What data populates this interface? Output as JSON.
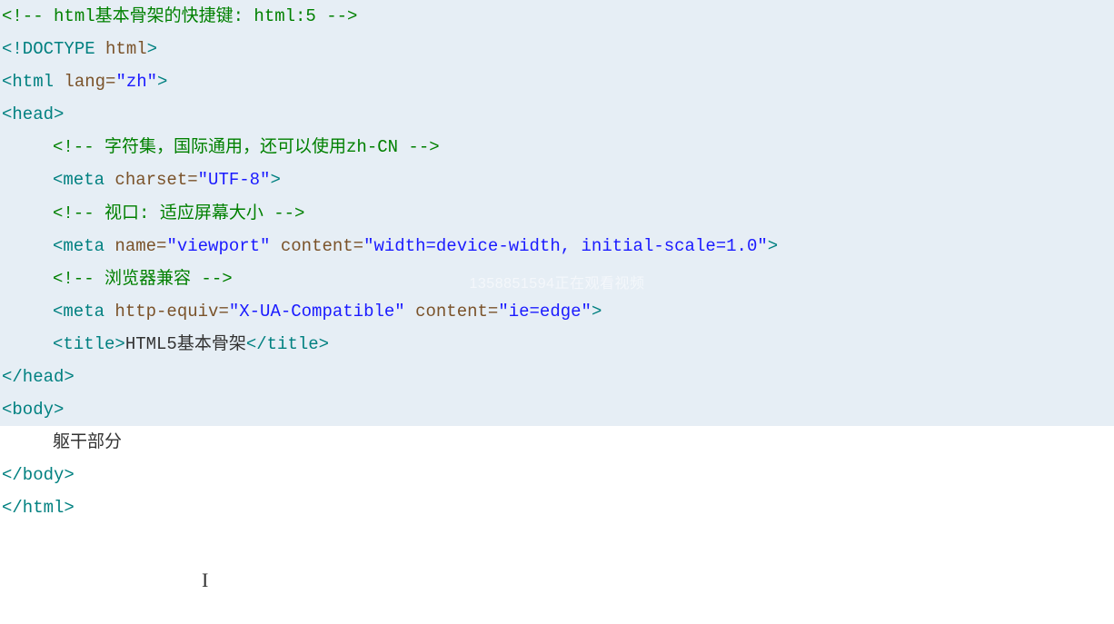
{
  "watermark": "1358851594正在观看视频",
  "cursor_char": "I",
  "code": {
    "l1": {
      "c1": "<!-- html基本骨架的快捷键: html:5 -->"
    },
    "l2": {
      "t1": "<!DOCTYPE ",
      "a1": "html",
      "t2": ">"
    },
    "l3": {
      "t1": "<html ",
      "a1": "lang=",
      "s1": "\"zh\"",
      "t2": ">"
    },
    "l4": {
      "t1": "<head>"
    },
    "l5": {
      "c1": "<!-- 字符集，国际通用，还可以使用zh-CN -->"
    },
    "l6": {
      "t1": "<meta ",
      "a1": "charset=",
      "s1": "\"UTF-8\"",
      "t2": ">"
    },
    "l7": {
      "c1": "<!-- 视口: 适应屏幕大小 -->"
    },
    "l8": {
      "t1": "<meta ",
      "a1": "name=",
      "s1": "\"viewport\"",
      "a2": " content=",
      "s2": "\"width=device-width, initial-scale=1.0\"",
      "t2": ">"
    },
    "l9": {
      "c1": "<!-- 浏览器兼容 -->"
    },
    "l10": {
      "t1": "<meta ",
      "a1": "http-equiv=",
      "s1": "\"X-UA-Compatible\"",
      "a2": " content=",
      "s2": "\"ie=edge\"",
      "t2": ">"
    },
    "l11": {
      "t1": "<title>",
      "x1": "HTML5基本骨架",
      "t2": "</title>"
    },
    "l12": {
      "t1": "</head>"
    },
    "l13": {
      "t1": "<body>"
    },
    "l14": {
      "x1": "躯干部分"
    },
    "l15": {
      "t1": "</body>"
    },
    "l16": {
      "t1": "</html>"
    }
  }
}
